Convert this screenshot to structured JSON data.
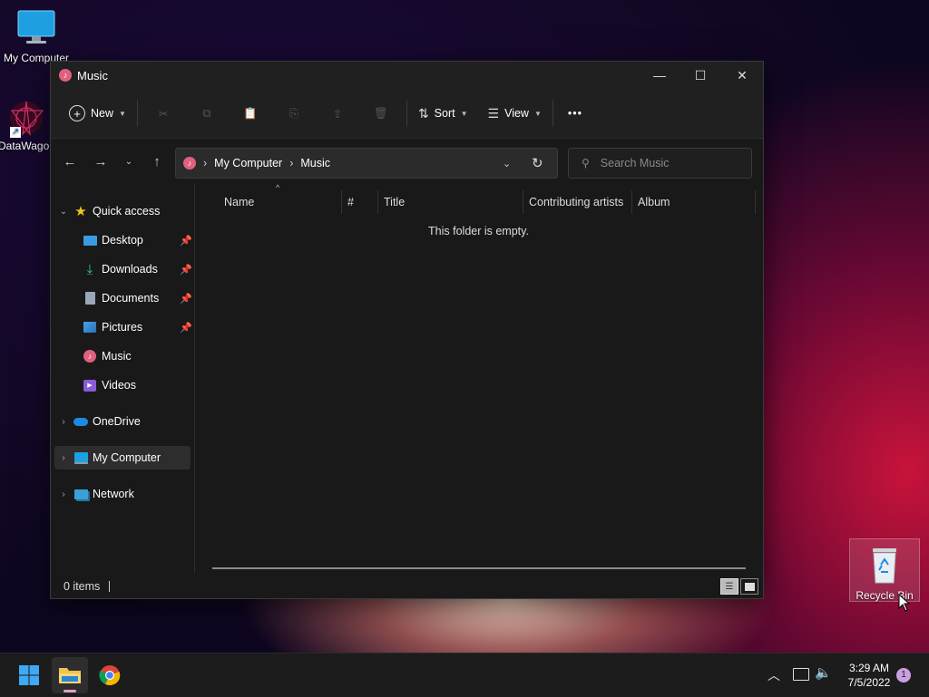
{
  "desktop": {
    "icons": [
      {
        "label": "My Computer"
      },
      {
        "label": "DataWago"
      },
      {
        "label": "Recycle Bin"
      }
    ]
  },
  "window": {
    "title": "Music",
    "minimize": "—",
    "maximize": "☐",
    "close": "✕"
  },
  "toolbar": {
    "new_label": "New",
    "sort_label": "Sort",
    "view_label": "View",
    "more_label": "•••"
  },
  "address": {
    "crumbs": [
      "My Computer",
      "Music"
    ]
  },
  "search": {
    "placeholder": "Search Music"
  },
  "sidebar": {
    "items": [
      {
        "label": "Quick access",
        "icon": "star-icon"
      },
      {
        "label": "Desktop",
        "icon": "desktop-icon",
        "pinned": true
      },
      {
        "label": "Downloads",
        "icon": "downloads-icon",
        "pinned": true
      },
      {
        "label": "Documents",
        "icon": "documents-icon",
        "pinned": true
      },
      {
        "label": "Pictures",
        "icon": "pictures-icon",
        "pinned": true
      },
      {
        "label": "Music",
        "icon": "music-icon"
      },
      {
        "label": "Videos",
        "icon": "videos-icon"
      },
      {
        "label": "OneDrive",
        "icon": "onedrive-icon"
      },
      {
        "label": "My Computer",
        "icon": "computer-icon",
        "selected": true
      },
      {
        "label": "Network",
        "icon": "network-icon"
      }
    ]
  },
  "columns": [
    "Name",
    "#",
    "Title",
    "Contributing artists",
    "Album"
  ],
  "content": {
    "empty_message": "This folder is empty."
  },
  "status": {
    "items_count": "0 items"
  },
  "taskbar": {
    "time": "3:29 AM",
    "date": "7/5/2022",
    "notifications": "1"
  },
  "colors": {
    "accent": "#0078d4",
    "music_icon": "#e0607e",
    "folder": "#f2c14e"
  }
}
